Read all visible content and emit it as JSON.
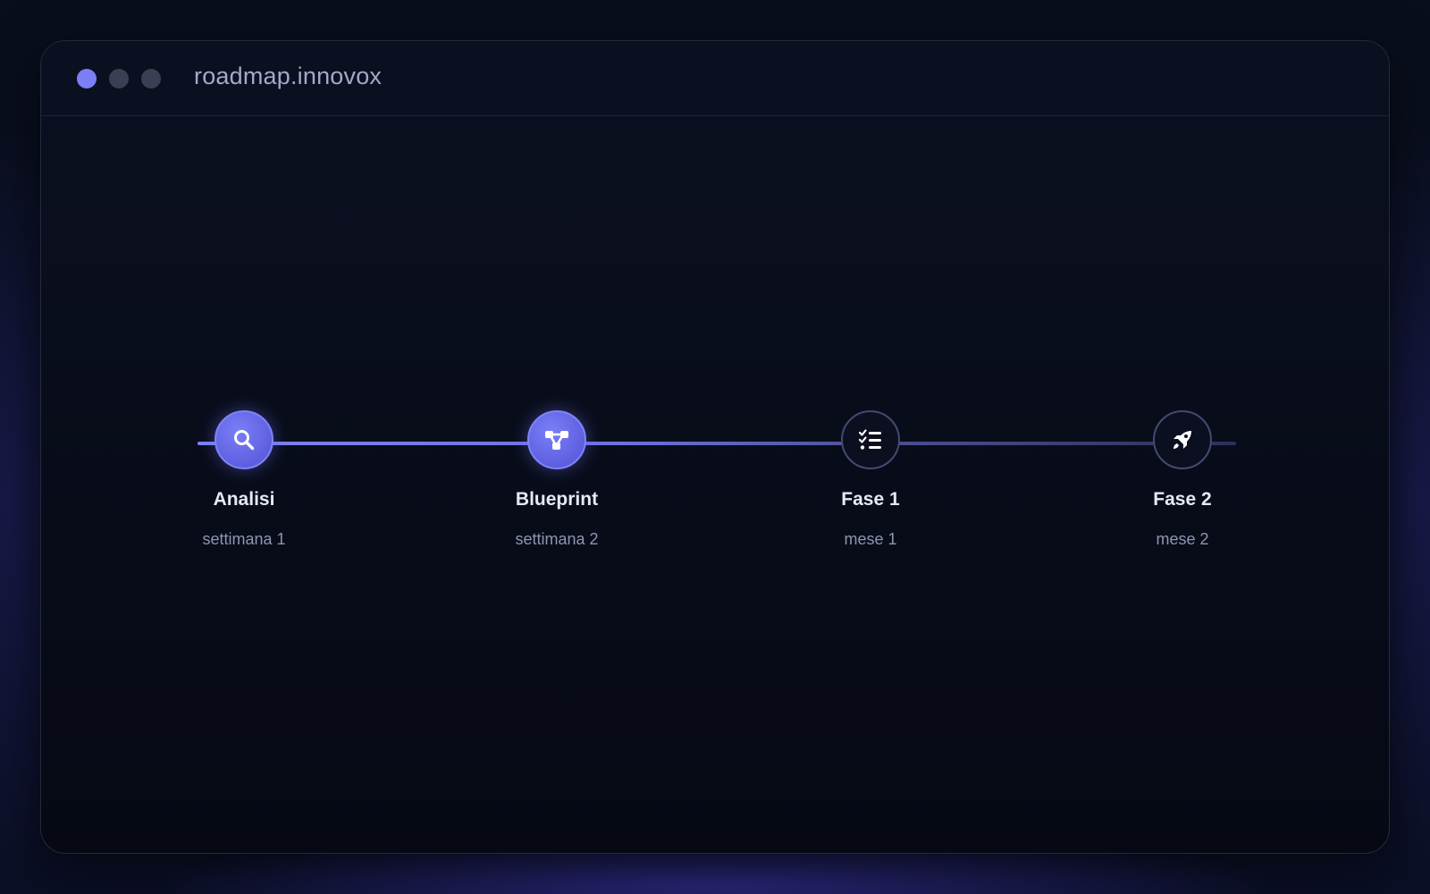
{
  "window": {
    "title": "roadmap.innovox"
  },
  "timeline": {
    "milestones": [
      {
        "label": "Analisi",
        "sub": "settimana 1",
        "icon": "search-icon",
        "state": "done"
      },
      {
        "label": "Blueprint",
        "sub": "settimana 2",
        "icon": "flow-icon",
        "state": "done"
      },
      {
        "label": "Fase 1",
        "sub": "mese 1",
        "icon": "checklist-icon",
        "state": "pending"
      },
      {
        "label": "Fase 2",
        "sub": "mese 2",
        "icon": "rocket-icon",
        "state": "pending"
      }
    ]
  },
  "colors": {
    "accent": "#7b7ff6",
    "active_node": "#5e5fe0",
    "pending_border": "#444a70",
    "background": "#080c1a"
  }
}
